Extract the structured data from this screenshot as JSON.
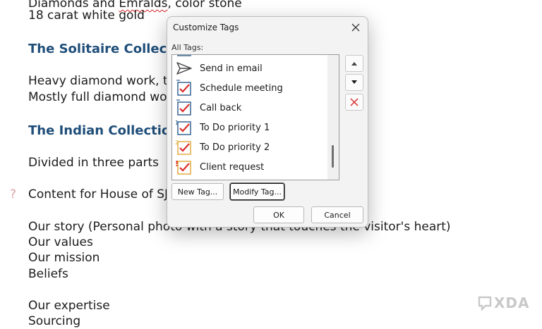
{
  "document": {
    "line_top_partial": "Diamonds and Emralds, color stone",
    "line_top_misspelled": "Emralds",
    "line_gold": "18 carat white gold",
    "heading_solitaire": "The Solitaire Collection",
    "line_heavy": "Heavy diamond work, tal",
    "line_mostly": "Mostly full diamond work",
    "heading_indian": "The Indian Collection",
    "line_divided": "Divided in three parts",
    "line_content": "Content for House of SJ-I",
    "line_story": "Our story (Personal photo with a story that touches the visitor's heart)",
    "line_values": "Our values",
    "line_mission": "Our mission",
    "line_beliefs": "Beliefs",
    "line_expertise": "Our expertise",
    "line_sourcing": "Sourcing",
    "margin_marker": "?"
  },
  "dialog": {
    "title": "Customize Tags",
    "all_tags_label": "All Tags:",
    "tags": [
      {
        "label": "Send in email",
        "icon": "send-email-icon"
      },
      {
        "label": "Schedule meeting",
        "icon": "checkbox-checked-icon"
      },
      {
        "label": "Call back",
        "icon": "checkbox-checked-icon"
      },
      {
        "label": "To Do priority 1",
        "icon": "checkbox-checked-icon",
        "badge": "1"
      },
      {
        "label": "To Do priority 2",
        "icon": "checkbox-checked-icon",
        "badge": "2"
      },
      {
        "label": "Client request",
        "icon": "checkbox-checked-icon",
        "badge": "!"
      }
    ],
    "new_tag_label": "New Tag...",
    "modify_tag_label": "Modify Tag...",
    "ok_label": "OK",
    "cancel_label": "Cancel"
  },
  "watermark": {
    "text": "XDA"
  },
  "colors": {
    "heading": "#1f4e79",
    "checkmark": "#d9302c",
    "checkbox_border": "#2b5a8c",
    "delete_x": "#d9302c"
  }
}
